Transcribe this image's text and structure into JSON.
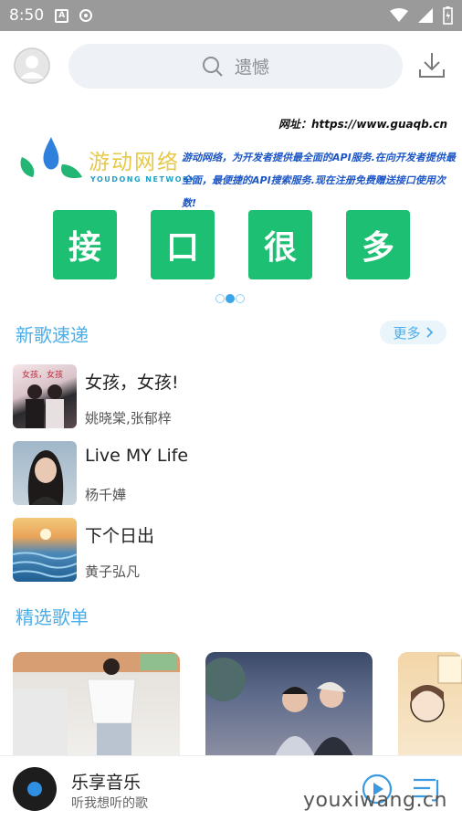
{
  "status_bar": {
    "time": "8:50",
    "notif_a": "A"
  },
  "header": {
    "search_placeholder": "遗憾"
  },
  "banner": {
    "url": "网址：https://www.guaqb.cn",
    "brand_cn": "游动网络",
    "brand_en": "YOUDONG NETWORK",
    "description": "游动网络，为开发者提供最全面的API服务.在向开发者提供最全面，最便捷的API搜索服务.现在注册免费赠送接口使用次数!",
    "tiles": [
      "接",
      "口",
      "很",
      "多"
    ],
    "active_dot": 1
  },
  "new_songs": {
    "title": "新歌速递",
    "more_label": "更多",
    "items": [
      {
        "name": "女孩，女孩!",
        "artist": "姚晓棠,张郁梓"
      },
      {
        "name": "Live MY Life",
        "artist": "杨千嬅"
      },
      {
        "name": "下个日出",
        "artist": "黄子弘凡"
      }
    ]
  },
  "playlists_section": {
    "title": "精选歌单"
  },
  "player": {
    "title": "乐享音乐",
    "subtitle": "听我想听的歌"
  },
  "watermark": "youxiwang.cn",
  "colors": {
    "accent": "#4aaee8",
    "tile_green": "#1dbf73",
    "status_bar": "#9a9a9a"
  }
}
